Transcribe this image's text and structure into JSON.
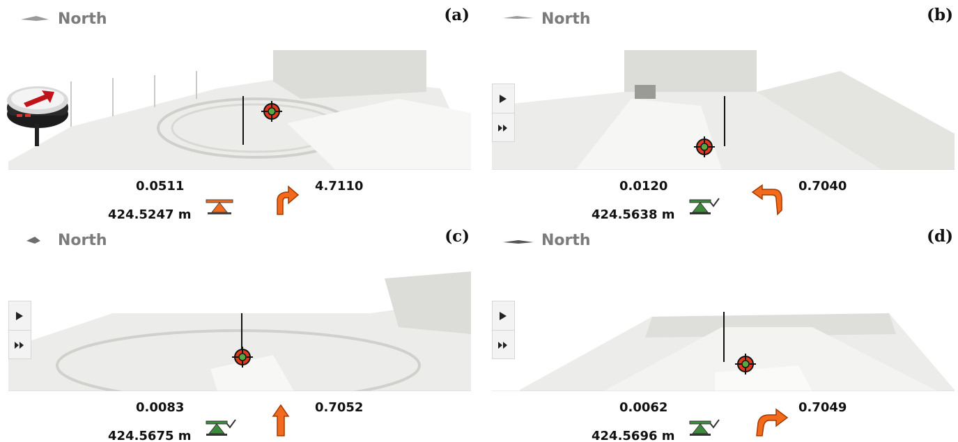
{
  "colors": {
    "orange": "#f26a1b",
    "green_level": "#3d8a3d",
    "north_gray": "#7b7b7b",
    "target_red": "#e03a1e",
    "target_green": "#5aa844"
  },
  "panels": [
    {
      "id": "a",
      "panel_label": "(a)",
      "compass_label": "North",
      "deviation": "0.0511",
      "height": "424.5247 m",
      "angle": "4.7110",
      "level_icon": "level-off-icon",
      "direction_icon": "turn-up-right-arrow-icon",
      "has_side_buttons": false,
      "has_gnss_icon": true
    },
    {
      "id": "b",
      "panel_label": "(b)",
      "compass_label": "North",
      "deviation": "0.0120",
      "height": "424.5638 m",
      "angle": "0.7040",
      "level_icon": "level-ok-icon",
      "direction_icon": "turn-back-left-arrow-icon",
      "has_side_buttons": true,
      "has_gnss_icon": false
    },
    {
      "id": "c",
      "panel_label": "(c)",
      "compass_label": "North",
      "deviation": "0.0083",
      "height": "424.5675 m",
      "angle": "0.7052",
      "level_icon": "level-ok-icon",
      "direction_icon": "straight-up-arrow-icon",
      "has_side_buttons": true,
      "has_gnss_icon": false
    },
    {
      "id": "d",
      "panel_label": "(d)",
      "compass_label": "North",
      "deviation": "0.0062",
      "height": "424.5696 m",
      "angle": "0.7049",
      "level_icon": "level-ok-icon",
      "direction_icon": "turn-right-arrow-icon",
      "has_side_buttons": true,
      "has_gnss_icon": false
    }
  ]
}
